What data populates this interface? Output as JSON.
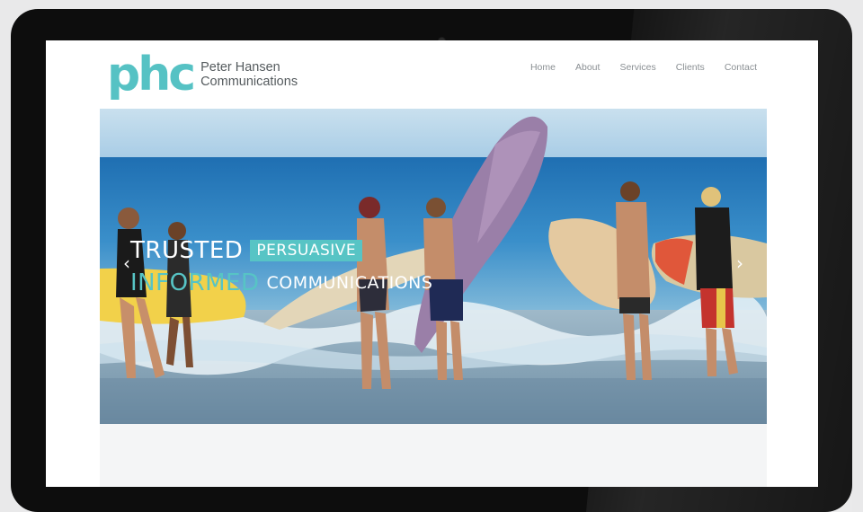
{
  "site": {
    "logo": {
      "mark": "phc",
      "name_line1": "Peter Hansen",
      "name_line2": "Communications"
    },
    "nav": [
      {
        "label": "Home"
      },
      {
        "label": "About"
      },
      {
        "label": "Services"
      },
      {
        "label": "Clients"
      },
      {
        "label": "Contact"
      }
    ],
    "hero": {
      "line1_word": "TRUSTED",
      "line1_box": "PERSUASIVE",
      "line2_word": "INFORMED",
      "line2_rest": "COMMUNICATIONS",
      "prev_glyph": "‹",
      "next_glyph": "›"
    }
  },
  "colors": {
    "accent": "#57c4c5",
    "bezel": "#0d0d0d",
    "nav_text": "#8a8f93"
  }
}
